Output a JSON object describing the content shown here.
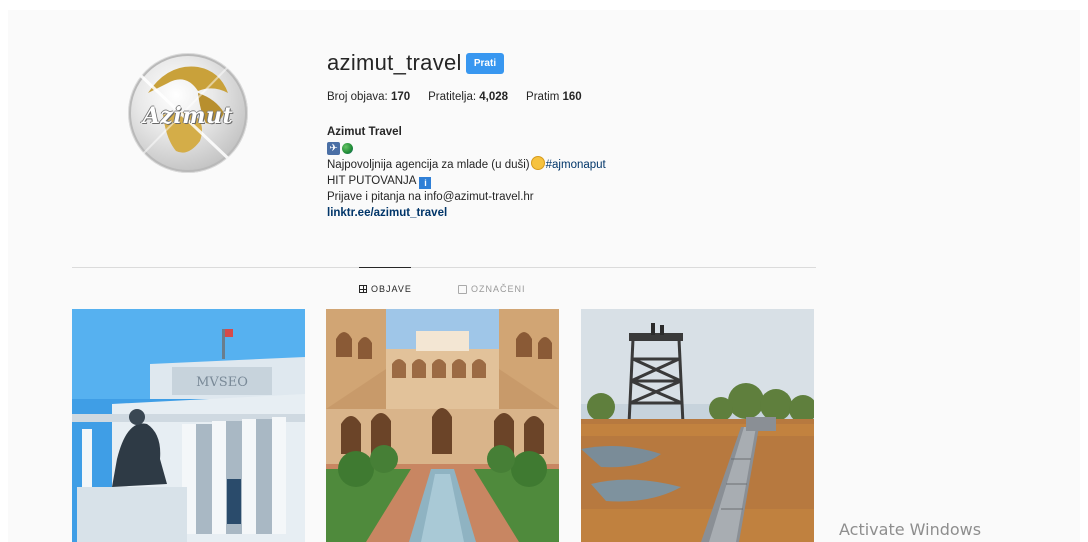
{
  "profile": {
    "username": "azimut_travel",
    "follow_label": "Prati",
    "avatar_brand": "Azimut",
    "stats": {
      "posts_label": "Broj objava:",
      "posts_value": "170",
      "followers_label": "Pratitelja:",
      "followers_value": "4,028",
      "following_label": "Pratim",
      "following_value": "160"
    },
    "bio": {
      "full_name": "Azimut Travel",
      "line1_text": "Najpovoljnija agencija za mlade (u duši)",
      "hashtag": "#ajmonaput",
      "line2_text": "HIT PUTOVANJA",
      "line3_text": "Prijave i pitanja na info@azimut-travel.hr",
      "link": "linktr.ee/azimut_travel"
    }
  },
  "tabs": [
    {
      "label": "OBJAVE",
      "icon": "grid-icon",
      "active": true
    },
    {
      "label": "OZNAČENI",
      "icon": "tag-icon",
      "active": false
    }
  ],
  "posts": [
    {
      "subject": "museum-building"
    },
    {
      "subject": "palace-courtyard"
    },
    {
      "subject": "watchtower-boardwalk"
    }
  ],
  "watermark": "Activate Windows",
  "colors": {
    "accent": "#3897f0",
    "link": "#003569",
    "background": "#fafafa"
  }
}
